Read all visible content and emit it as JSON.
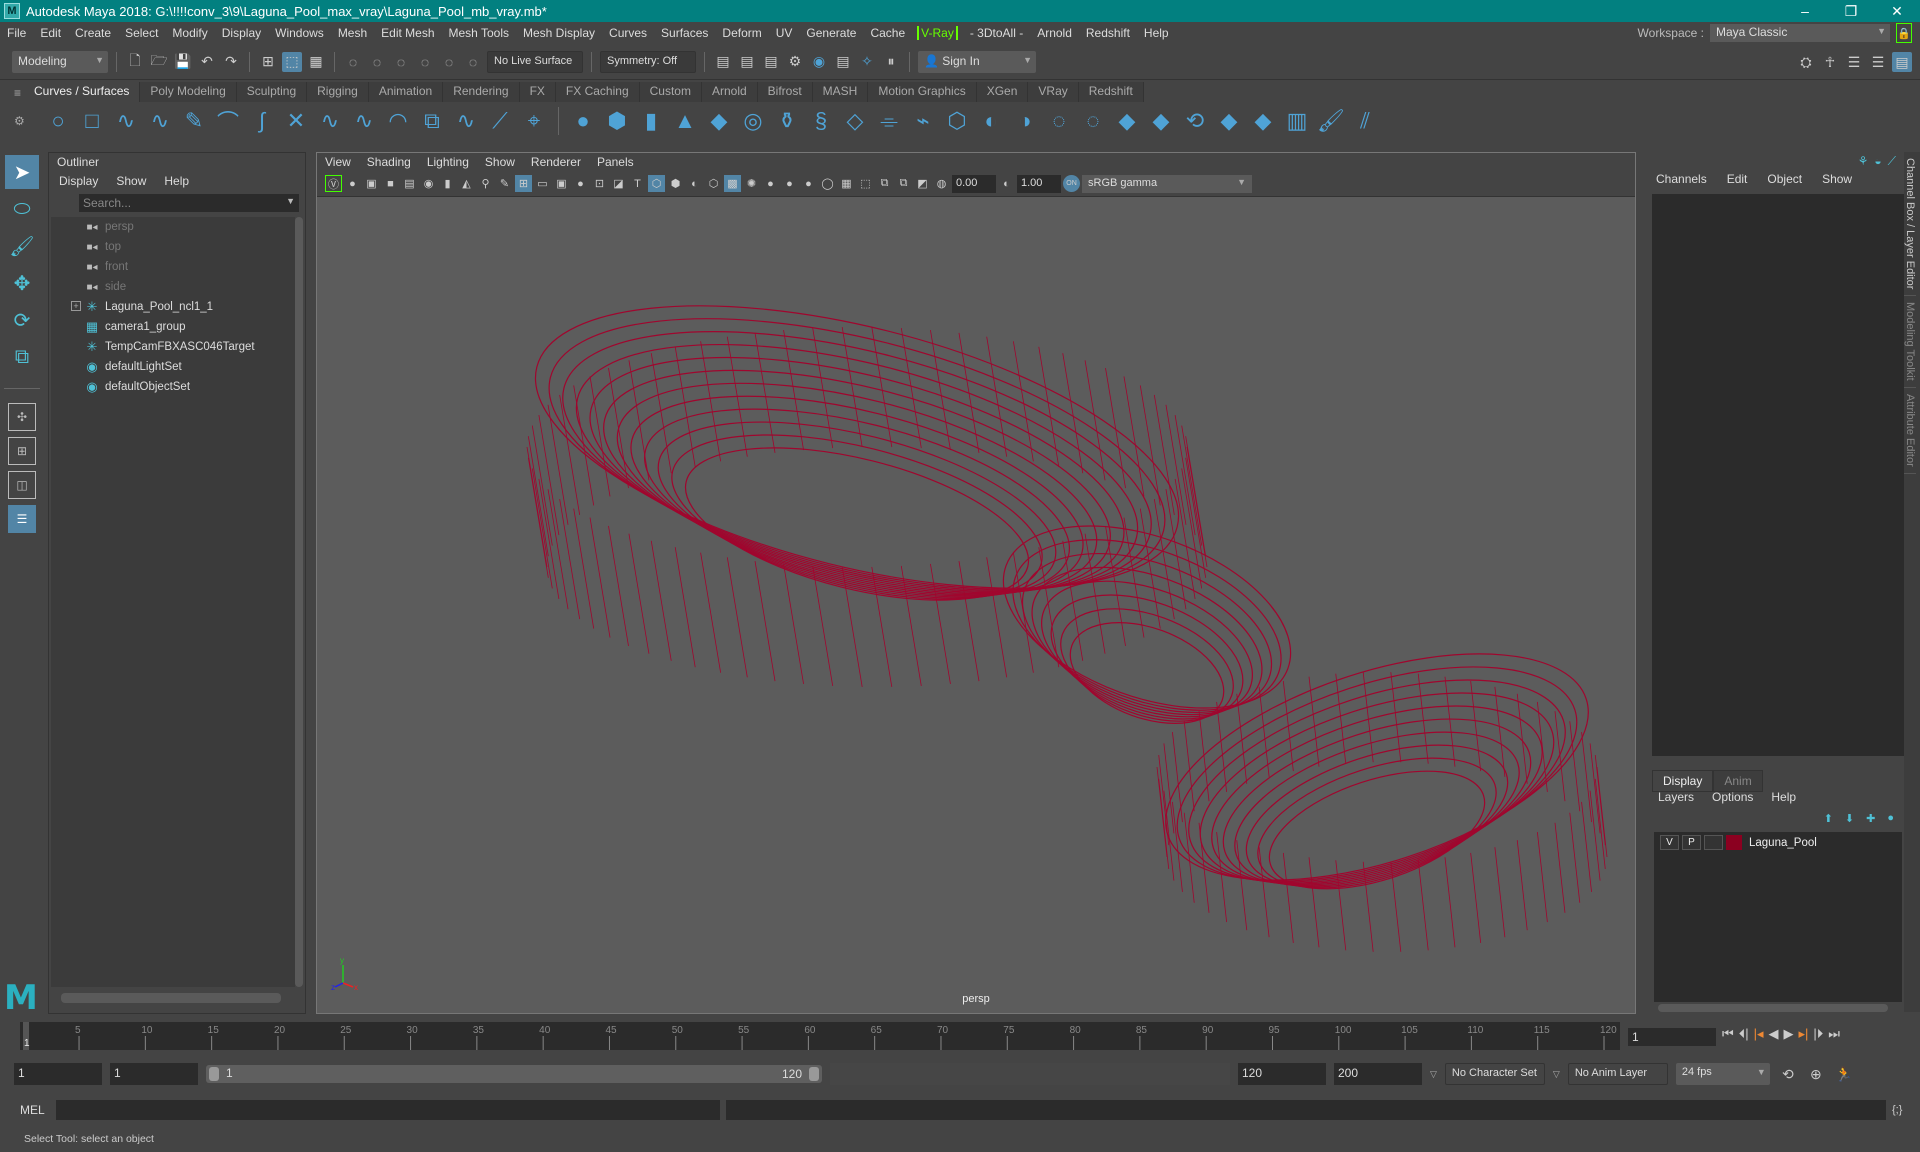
{
  "app": {
    "title": "Autodesk Maya 2018: G:\\!!!!conv_3\\9\\Laguna_Pool_max_vray\\Laguna_Pool_mb_vray.mb*",
    "window_buttons": [
      "minimize",
      "maximize",
      "close"
    ]
  },
  "menubar": {
    "items": [
      "File",
      "Edit",
      "Create",
      "Select",
      "Modify",
      "Display",
      "Windows",
      "Mesh",
      "Edit Mesh",
      "Mesh Tools",
      "Mesh Display",
      "Curves",
      "Surfaces",
      "Deform",
      "UV",
      "Generate",
      "Cache"
    ],
    "vray": "V-Ray",
    "extra": [
      "- 3DtoAll -",
      "Arnold",
      "Redshift",
      "Help"
    ],
    "workspace_label": "Workspace :",
    "workspace_value": "Maya Classic"
  },
  "statusline": {
    "mode": "Modeling",
    "live_surface": "No Live Surface",
    "symmetry": "Symmetry: Off",
    "sign_in": "Sign In"
  },
  "shelf": {
    "tabs": [
      "Curves / Surfaces",
      "Poly Modeling",
      "Sculpting",
      "Rigging",
      "Animation",
      "Rendering",
      "FX",
      "FX Caching",
      "Custom",
      "Arnold",
      "Bifrost",
      "MASH",
      "Motion Graphics",
      "XGen",
      "VRay",
      "Redshift"
    ],
    "active_tab": "Curves / Surfaces"
  },
  "outliner": {
    "title": "Outliner",
    "menus": [
      "Display",
      "Show",
      "Help"
    ],
    "search_placeholder": "Search...",
    "items": [
      {
        "label": "persp",
        "icon": "camera-icon",
        "dim": true
      },
      {
        "label": "top",
        "icon": "camera-icon",
        "dim": true
      },
      {
        "label": "front",
        "icon": "camera-icon",
        "dim": true
      },
      {
        "label": "side",
        "icon": "camera-icon",
        "dim": true
      },
      {
        "label": "Laguna_Pool_ncl1_1",
        "icon": "locator-icon",
        "expandable": true
      },
      {
        "label": "camera1_group",
        "icon": "group-icon"
      },
      {
        "label": "TempCamFBXASC046Target",
        "icon": "locator-icon"
      },
      {
        "label": "defaultLightSet",
        "icon": "set-icon"
      },
      {
        "label": "defaultObjectSet",
        "icon": "set-icon"
      }
    ]
  },
  "viewport": {
    "menus": [
      "View",
      "Shading",
      "Lighting",
      "Show",
      "Renderer",
      "Panels"
    ],
    "exposure": "0.00",
    "gamma": "1.00",
    "color_space": "sRGB gamma",
    "camera": "persp",
    "wire_color": "#a0062e",
    "axis": {
      "x": "x",
      "y": "y",
      "z": "z"
    }
  },
  "channelbox": {
    "menus": [
      "Channels",
      "Edit",
      "Object",
      "Show"
    ]
  },
  "layers": {
    "tabs": [
      "Display",
      "Anim"
    ],
    "menus": [
      "Layers",
      "Options",
      "Help"
    ],
    "rows": [
      {
        "v": "V",
        "p": "P",
        "name": "Laguna_Pool",
        "color": "#8b0020"
      }
    ]
  },
  "side_tabs": [
    "Channel Box / Layer Editor",
    "Modeling Toolkit",
    "Attribute Editor"
  ],
  "timeline": {
    "ticks": [
      "5",
      "10",
      "15",
      "20",
      "25",
      "30",
      "35",
      "40",
      "45",
      "50",
      "55",
      "60",
      "65",
      "70",
      "75",
      "80",
      "85",
      "90",
      "95",
      "100",
      "105",
      "110",
      "115",
      "120"
    ],
    "current_marker": "1",
    "current_frame": "1"
  },
  "range": {
    "start": "1",
    "playback_start": "1",
    "slider_start": "1",
    "slider_end": "120",
    "playback_end": "120",
    "end": "200",
    "character_set": "No Character Set",
    "anim_layer": "No Anim Layer",
    "fps": "24 fps"
  },
  "command": {
    "label": "MEL"
  },
  "help_line": "Select Tool: select an object"
}
